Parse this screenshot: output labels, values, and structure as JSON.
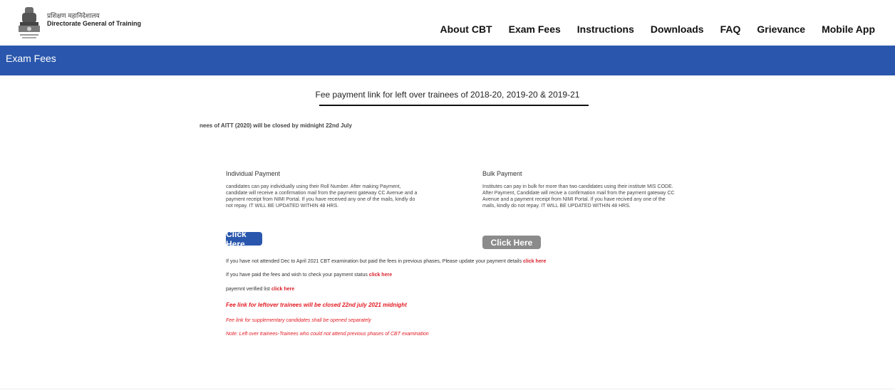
{
  "header": {
    "brand_hindi": "प्रशिक्षण महानिदेशालय",
    "brand_english": "Directorate General of Training",
    "emblem_icon": "national-emblem-icon",
    "nav": [
      {
        "label": "About CBT"
      },
      {
        "label": "Exam Fees"
      },
      {
        "label": "Instructions"
      },
      {
        "label": "Downloads"
      },
      {
        "label": "FAQ"
      },
      {
        "label": "Grievance"
      },
      {
        "label": "Mobile App"
      }
    ]
  },
  "banner": {
    "title": "Exam Fees",
    "color": "#2a57ad"
  },
  "main": {
    "heading": "Fee payment link for left over trainees of 2018-20, 2019-20 & 2019-21",
    "marquee": "nees of AITT (2020) will be closed by midnight 22nd July",
    "individual": {
      "title": "Individual Payment",
      "text": "candidates can pay individually using their Roll Number. After making Payment, candidate will receive a confirmation mail from the payment gateway CC Avenue and a payment receipt from NIMI Portal. If you have received any one of the mails, kindly do not repay. IT WILL BE UPDATED WITHIN 48 HRS.",
      "button": "Click Here"
    },
    "bulk": {
      "title": "Bulk Payment",
      "text": "Institutes can pay in bulk for more than two candidates using their institute MIS CODE. After Payment, Candidate will recive a confirmation mail from the payment gateway CC Avenue and a payment receipt from NIMI Portal. If you have recived any one of the mails, kindly do not repay. IT WILL BE UPDATED WITHIN 48 HRS.",
      "button": "Click Here"
    },
    "line1": {
      "text": "If you have not attended Dec to April 2021 CBT examination but paid the fees in previous phases, Please update your payment details ",
      "link": "click here"
    },
    "line2": {
      "text": "If you have paid the fees and wish to check your payment status ",
      "link": "click here"
    },
    "line3": {
      "text": "payemnt verified list ",
      "link": "click here"
    },
    "notice_bold": "Fee link for leftover trainees will be closed 22nd july 2021 midnight",
    "notice_supp": "Fee link for supplementary candidates shall be opened separately",
    "notice_note": "Note: Left over trainees-Trainees who could not attend previous phases of CBT examination"
  }
}
